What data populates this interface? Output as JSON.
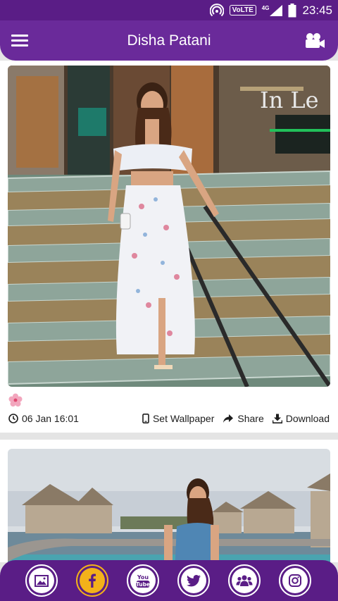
{
  "status_bar": {
    "volte_label": "VoLTE",
    "network_label": "4G",
    "time": "23:45"
  },
  "header": {
    "title": "Disha Patani"
  },
  "posts": [
    {
      "date": "06 Jan 16:01",
      "set_wallpaper_label": "Set Wallpaper",
      "share_label": "Share",
      "download_label": "Download",
      "photo_sign": "In Le"
    }
  ],
  "bottom_nav": [
    {
      "name": "gallery-icon"
    },
    {
      "name": "facebook-icon"
    },
    {
      "name": "youtube-icon",
      "label": "You Tube"
    },
    {
      "name": "twitter-icon"
    },
    {
      "name": "group-icon"
    },
    {
      "name": "instagram-icon"
    }
  ],
  "colors": {
    "primary": "#6a2a9a",
    "primary_dark": "#5a1d86",
    "accent": "#f3b21a"
  }
}
